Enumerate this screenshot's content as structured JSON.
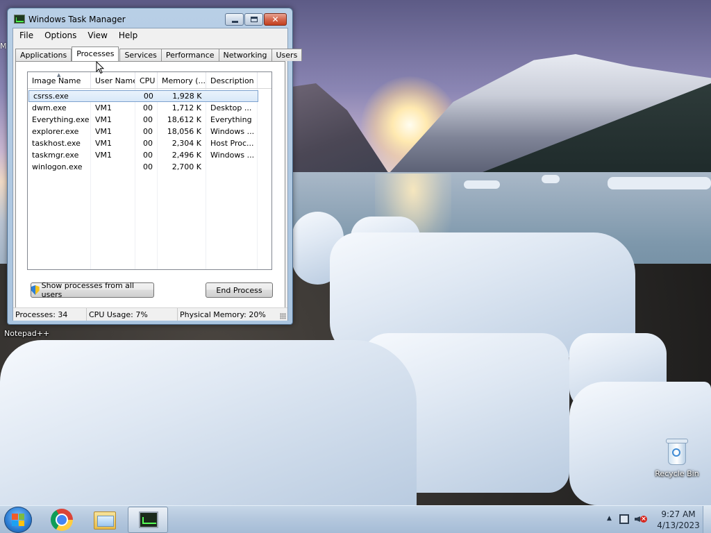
{
  "window": {
    "title": "Windows Task Manager",
    "caption": {
      "minimize": "",
      "maximize": "",
      "close": "✕"
    }
  },
  "menu": [
    "File",
    "Options",
    "View",
    "Help"
  ],
  "tabs": [
    "Applications",
    "Processes",
    "Services",
    "Performance",
    "Networking",
    "Users"
  ],
  "active_tab": "Processes",
  "process_list": {
    "columns": [
      "Image Name",
      "User Name",
      "CPU",
      "Memory (...",
      "Description"
    ],
    "sorted_by": "Image Name",
    "rows": [
      {
        "name": "csrss.exe",
        "user": "",
        "cpu": "00",
        "mem": "1,928 K",
        "desc": "",
        "selected": true
      },
      {
        "name": "dwm.exe",
        "user": "VM1",
        "cpu": "00",
        "mem": "1,712 K",
        "desc": "Desktop ..."
      },
      {
        "name": "Everything.exe",
        "user": "VM1",
        "cpu": "00",
        "mem": "18,612 K",
        "desc": "Everything"
      },
      {
        "name": "explorer.exe",
        "user": "VM1",
        "cpu": "00",
        "mem": "18,056 K",
        "desc": "Windows ..."
      },
      {
        "name": "taskhost.exe",
        "user": "VM1",
        "cpu": "00",
        "mem": "2,304 K",
        "desc": "Host Proc..."
      },
      {
        "name": "taskmgr.exe",
        "user": "VM1",
        "cpu": "00",
        "mem": "2,496 K",
        "desc": "Windows ..."
      },
      {
        "name": "winlogon.exe",
        "user": "",
        "cpu": "00",
        "mem": "2,700 K",
        "desc": ""
      }
    ]
  },
  "buttons": {
    "show_all": "Show processes from all users",
    "end_process": "End Process"
  },
  "status": {
    "processes": "Processes: 34",
    "cpu": "CPU Usage: 7%",
    "memory": "Physical Memory: 20%"
  },
  "desktop": {
    "icons": {
      "notepad": "Notepad++",
      "recycle_bin": "Recycle Bin"
    },
    "partial_label": "M"
  },
  "taskbar": {
    "pinned": [
      "start-button",
      "chrome-icon",
      "explorer-folder-icon",
      "task-manager-icon"
    ],
    "clock_time": "9:27 AM",
    "clock_date": "4/13/2023"
  }
}
